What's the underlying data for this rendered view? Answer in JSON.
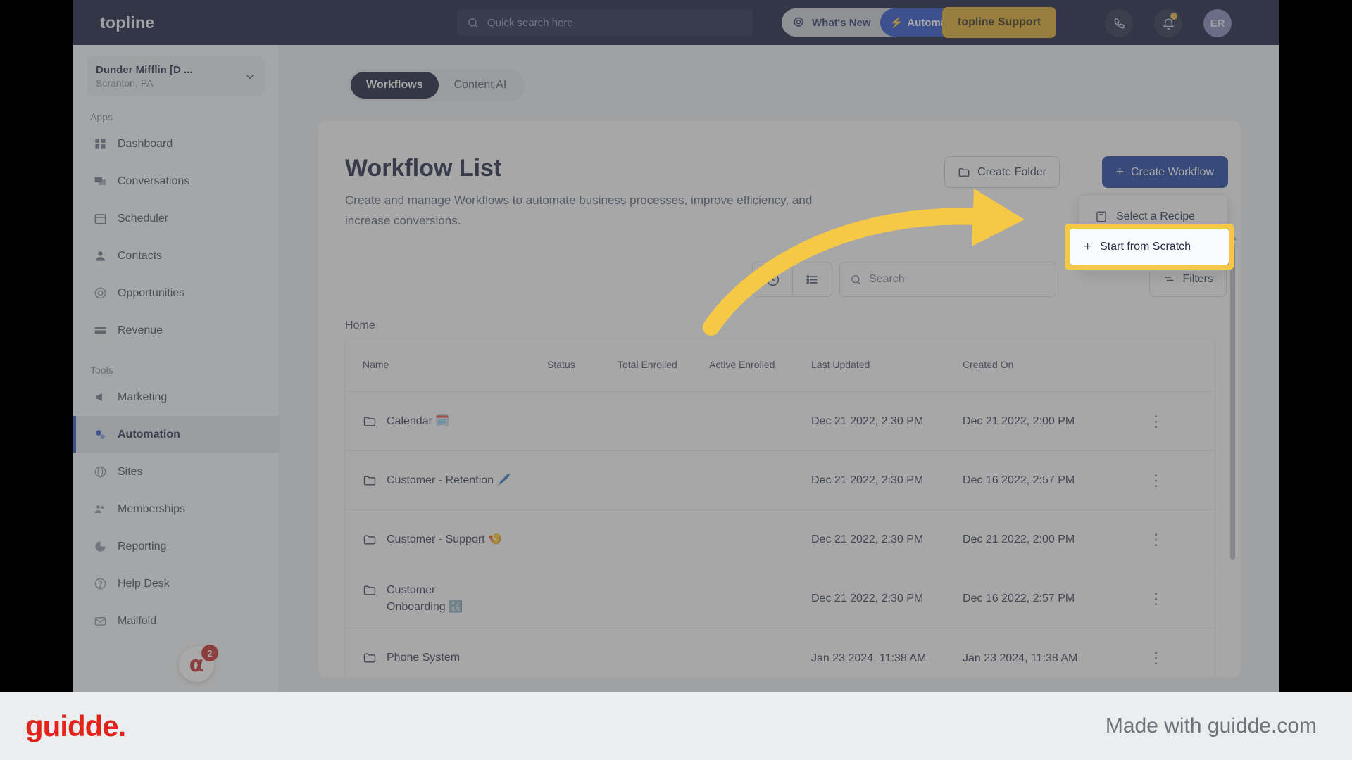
{
  "topbar": {
    "logo": "topline",
    "search_placeholder": "Quick search here",
    "search_icon": "search-icon",
    "whats_new_label": "What's New",
    "automation_pill": "Automation Updates",
    "support_button": "topline Support",
    "phone_icon": "phone-icon",
    "bell_icon": "bell-icon",
    "avatar_initials": "ER"
  },
  "sidebar": {
    "location_name": "Dunder Mifflin [D ...",
    "location_sub": "Scranton, PA",
    "chevron_icon": "chevron-down-icon",
    "panel_toggle_icon": "panel-toggle-icon",
    "apps_header": "Apps",
    "tools_header": "Tools",
    "apps": [
      {
        "label": "Dashboard",
        "icon": "dashboard-icon"
      },
      {
        "label": "Conversations",
        "icon": "chat-icon"
      },
      {
        "label": "Scheduler",
        "icon": "calendar-icon"
      },
      {
        "label": "Contacts",
        "icon": "person-icon"
      },
      {
        "label": "Opportunities",
        "icon": "target-icon"
      },
      {
        "label": "Revenue",
        "icon": "card-icon"
      }
    ],
    "tools": [
      {
        "label": "Marketing",
        "icon": "megaphone-icon"
      },
      {
        "label": "Automation",
        "icon": "gears-icon",
        "active": true
      },
      {
        "label": "Sites",
        "icon": "globe-icon"
      },
      {
        "label": "Memberships",
        "icon": "members-icon"
      },
      {
        "label": "Reporting",
        "icon": "piechart-icon"
      },
      {
        "label": "Help Desk",
        "icon": "question-icon"
      },
      {
        "label": "Mailfold",
        "icon": "mail-icon"
      }
    ],
    "omni_badge_count": "2",
    "omni_icon": "omni-logo-icon"
  },
  "main": {
    "tabs": [
      {
        "label": "Workflows",
        "active": true
      },
      {
        "label": "Content AI",
        "active": false
      }
    ],
    "page_title": "Workflow List",
    "page_desc": "Create and manage Workflows to automate business processes, improve efficiency, and increase conversions.",
    "create_folder_label": "Create Folder",
    "folder_icon": "folder-icon",
    "create_workflow_label": "Create Workflow",
    "plus_icon": "plus-icon",
    "dropdown": {
      "select_recipe_label": "Select a Recipe",
      "recipe_icon": "recipe-icon",
      "start_scratch_label": "Start from Scratch",
      "start_scratch_icon": "plus-icon"
    },
    "toolbar": {
      "history_icon": "clock-icon",
      "list_icon": "list-icon",
      "search_placeholder": "Search",
      "search_icon": "search-icon",
      "filters_label": "Filters",
      "filters_icon": "filter-icon"
    },
    "breadcrumb": "Home",
    "table": {
      "columns": [
        "Name",
        "Status",
        "Total Enrolled",
        "Active Enrolled",
        "Last Updated",
        "Created On"
      ],
      "rows": [
        {
          "name": "Calendar",
          "emoji": "🗓️",
          "status": "",
          "total": "",
          "active": "",
          "updated": "Dec 21 2022, 2:30 PM",
          "created": "Dec 21 2022, 2:00 PM"
        },
        {
          "name": "Customer - Retention",
          "emoji": "🖊️",
          "status": "",
          "total": "",
          "active": "",
          "updated": "Dec 21 2022, 2:30 PM",
          "created": "Dec 16 2022, 2:57 PM"
        },
        {
          "name": "Customer - Support",
          "emoji": "🍤",
          "status": "",
          "total": "",
          "active": "",
          "updated": "Dec 21 2022, 2:30 PM",
          "created": "Dec 21 2022, 2:00 PM"
        },
        {
          "name": "Customer Onboarding",
          "emoji": "🔣",
          "status": "",
          "total": "",
          "active": "",
          "updated": "Dec 21 2022, 2:30 PM",
          "created": "Dec 16 2022, 2:57 PM"
        },
        {
          "name": "Phone System",
          "emoji": "",
          "status": "",
          "total": "",
          "active": "",
          "updated": "Jan 23 2024, 11:38 AM",
          "created": "Jan 23 2024, 11:38 AM"
        }
      ],
      "row_menu_icon": "kebab-menu-icon"
    }
  },
  "highlight": {
    "label": "Start from Scratch",
    "icon": "plus-icon",
    "border_color": "#f5c946",
    "arrow_color": "#f5c946"
  },
  "footer": {
    "logo": "guidde.",
    "made_with": "Made with guidde.com",
    "logo_color": "#e2231a"
  }
}
